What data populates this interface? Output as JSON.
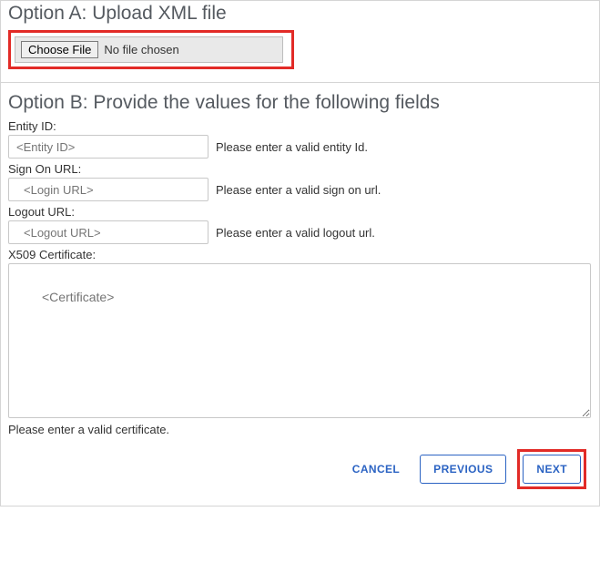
{
  "optionA": {
    "heading": "Option A: Upload XML file",
    "choose_file_label": "Choose File",
    "file_status": "No file chosen"
  },
  "optionB": {
    "heading": "Option B: Provide the values for the following fields",
    "entity_id": {
      "label": "Entity ID:",
      "placeholder": "<Entity ID>",
      "hint": "Please enter a valid entity Id."
    },
    "sign_on_url": {
      "label": "Sign On URL:",
      "placeholder": "<Login URL>",
      "hint": "Please enter a valid sign on url."
    },
    "logout_url": {
      "label": "Logout URL:",
      "placeholder": "<Logout URL>",
      "hint": "Please enter a valid logout url."
    },
    "certificate": {
      "label": "X509 Certificate:",
      "placeholder": "<Certificate>",
      "hint": "Please enter a valid certificate."
    }
  },
  "buttons": {
    "cancel": "CANCEL",
    "previous": "PREVIOUS",
    "next": "NEXT"
  }
}
